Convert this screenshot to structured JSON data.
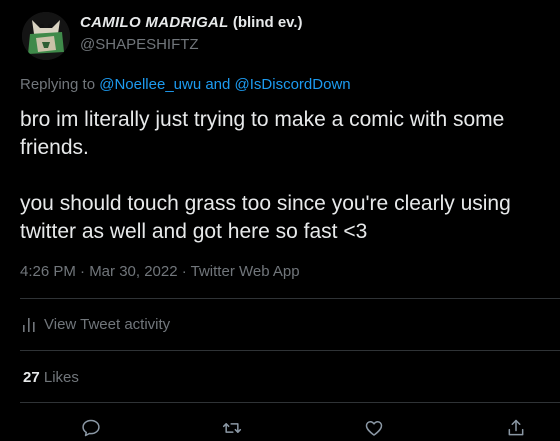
{
  "author": {
    "name_styled": "CAMILO MADRIGAL",
    "name_suffix": "(blind ev.)",
    "handle": "@SHAPESHIFTZ"
  },
  "replying": {
    "prefix": "Replying to",
    "users": "@Noellee_uwu and @IsDiscordDown"
  },
  "body": {
    "line1": "bro im literally just trying to make a comic with some",
    "line2": "friends.",
    "line3": "you should touch grass too since you're clearly using",
    "line4": "twitter as well and got here so fast <3"
  },
  "meta": {
    "timestamp": "4:26 PM · Mar 30, 2022 · Twitter Web App"
  },
  "activity": {
    "label": "View Tweet activity",
    "icon": "bar-chart-icon"
  },
  "likes": {
    "count": "27",
    "label": "Likes"
  },
  "actions": [
    {
      "icon": "reply-icon"
    },
    {
      "icon": "retweet-icon"
    },
    {
      "icon": "like-icon"
    },
    {
      "icon": "share-icon"
    }
  ],
  "colors": {
    "background": "#000000",
    "text": "#e7e9ea",
    "secondary": "#71767b",
    "link": "#1d9bf0",
    "divider": "#2f3336"
  }
}
